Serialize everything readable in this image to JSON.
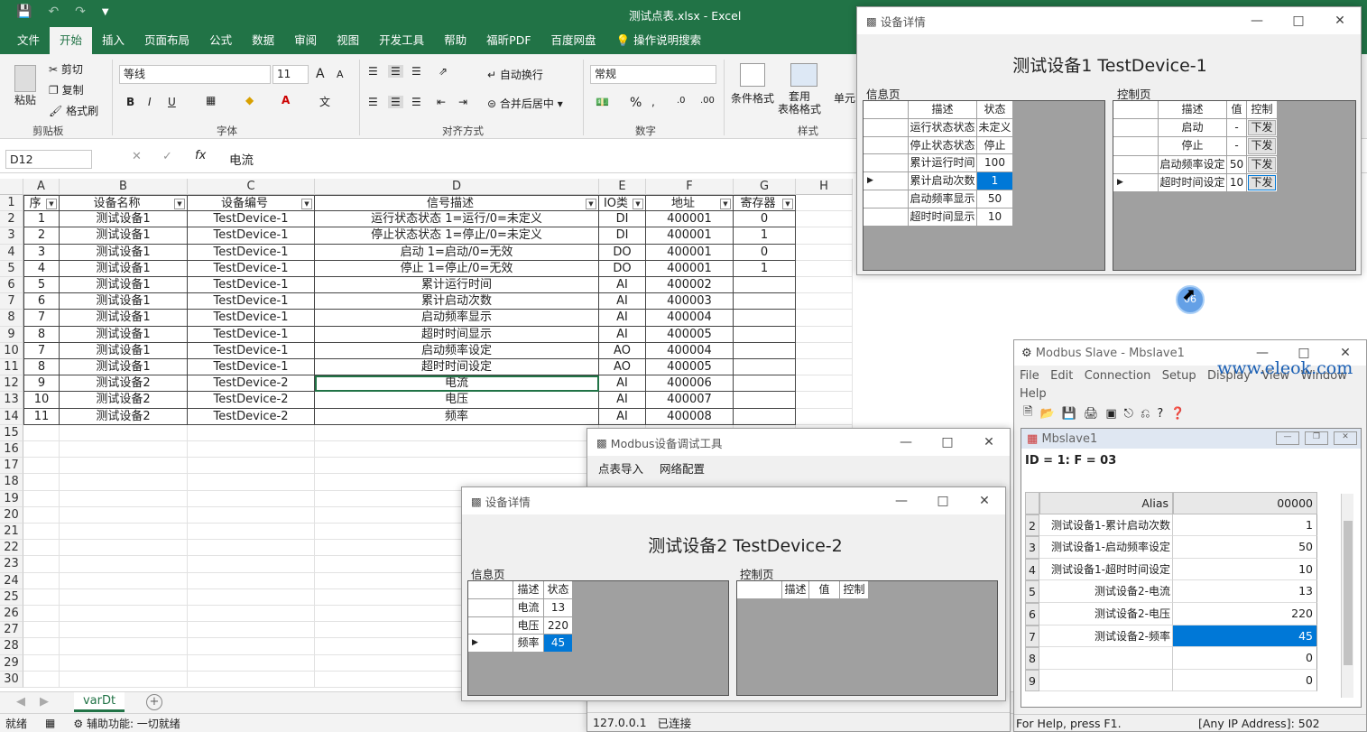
{
  "excel": {
    "title": "测试点表.xlsx  -  Excel",
    "qat_icons": [
      "save-icon",
      "undo-icon",
      "redo-icon",
      "customize-icon"
    ],
    "tabs": [
      "文件",
      "开始",
      "插入",
      "页面布局",
      "公式",
      "数据",
      "审阅",
      "视图",
      "开发工具",
      "帮助",
      "福昕PDF",
      "百度网盘",
      "操作说明搜索"
    ],
    "ribbon": {
      "clipboard": {
        "paste": "粘贴",
        "cut": "剪切",
        "copy": "复制",
        "format_painter": "格式刷",
        "label": "剪贴板"
      },
      "font": {
        "name": "等线",
        "size": "11",
        "label": "字体",
        "bold": "B",
        "italic": "I",
        "underline": "U",
        "grow": "A",
        "shrink": "A"
      },
      "align": {
        "wrap": "自动换行",
        "merge": "合并后居中",
        "label": "对齐方式"
      },
      "number": {
        "format": "常规",
        "label": "数字",
        "percent": "%"
      },
      "styles": {
        "cond": "条件格式",
        "table_format": "套用\n表格格式",
        "cell_styles": "单元",
        "label": "样式"
      }
    },
    "namebox": "D12",
    "formula": "电流",
    "fx": "fx",
    "columns": [
      "A",
      "B",
      "C",
      "D",
      "E",
      "F",
      "G",
      "H"
    ],
    "headers": [
      "序",
      "设备名称",
      "设备编号",
      "信号描述",
      "IO类",
      "地址",
      "寄存器"
    ],
    "rows": [
      [
        "1",
        "测试设备1",
        "TestDevice-1",
        "运行状态状态 1=运行/0=未定义",
        "DI",
        "400001",
        "0"
      ],
      [
        "2",
        "测试设备1",
        "TestDevice-1",
        "停止状态状态 1=停止/0=未定义",
        "DI",
        "400001",
        "1"
      ],
      [
        "3",
        "测试设备1",
        "TestDevice-1",
        "启动 1=启动/0=无效",
        "DO",
        "400001",
        "0"
      ],
      [
        "4",
        "测试设备1",
        "TestDevice-1",
        "停止 1=停止/0=无效",
        "DO",
        "400001",
        "1"
      ],
      [
        "5",
        "测试设备1",
        "TestDevice-1",
        "累计运行时间",
        "AI",
        "400002",
        ""
      ],
      [
        "6",
        "测试设备1",
        "TestDevice-1",
        "累计启动次数",
        "AI",
        "400003",
        ""
      ],
      [
        "7",
        "测试设备1",
        "TestDevice-1",
        "启动频率显示",
        "AI",
        "400004",
        ""
      ],
      [
        "8",
        "测试设备1",
        "TestDevice-1",
        "超时时间显示",
        "AI",
        "400005",
        ""
      ],
      [
        "7",
        "测试设备1",
        "TestDevice-1",
        "启动频率设定",
        "AO",
        "400004",
        ""
      ],
      [
        "8",
        "测试设备1",
        "TestDevice-1",
        "超时时间设定",
        "AO",
        "400005",
        ""
      ],
      [
        "9",
        "测试设备2",
        "TestDevice-2",
        "电流",
        "AI",
        "400006",
        ""
      ],
      [
        "10",
        "测试设备2",
        "TestDevice-2",
        "电压",
        "AI",
        "400007",
        ""
      ],
      [
        "11",
        "测试设备2",
        "TestDevice-2",
        "频率",
        "AI",
        "400008",
        ""
      ]
    ],
    "row_numbers": [
      "1",
      "2",
      "3",
      "4",
      "5",
      "6",
      "7",
      "8",
      "9",
      "10",
      "11",
      "12",
      "13",
      "14",
      "15",
      "16",
      "17",
      "18",
      "19",
      "20",
      "21",
      "22",
      "23",
      "24",
      "25",
      "26",
      "27",
      "28",
      "29",
      "30"
    ],
    "sheet_tab": "varDt",
    "status": {
      "ready": "就绪",
      "accessibility": "辅助功能: 一切就绪"
    }
  },
  "dev1": {
    "win_title": "设备详情",
    "heading": "测试设备1  TestDevice-1",
    "info_label": "信息页",
    "ctrl_label": "控制页",
    "info_cols": [
      "描述",
      "状态"
    ],
    "info_rows": [
      [
        "运行状态状态",
        "未定义"
      ],
      [
        "停止状态状态",
        "停止"
      ],
      [
        "累计运行时间",
        "100"
      ],
      [
        "累计启动次数",
        "1"
      ],
      [
        "启动频率显示",
        "50"
      ],
      [
        "超时时间显示",
        "10"
      ]
    ],
    "ctrl_cols": [
      "描述",
      "值",
      "控制"
    ],
    "ctrl_rows": [
      [
        "启动",
        "-",
        "下发"
      ],
      [
        "停止",
        "-",
        "下发"
      ],
      [
        "启动频率设定",
        "50",
        "下发"
      ],
      [
        "超时时间设定",
        "10",
        "下发"
      ]
    ]
  },
  "tool": {
    "win_title": "Modbus设备调试工具",
    "menu": [
      "点表导入",
      "网络配置"
    ],
    "status_ip": "127.0.0.1",
    "status_conn": "已连接"
  },
  "dev2": {
    "win_title": "设备详情",
    "heading": "测试设备2  TestDevice-2",
    "info_label": "信息页",
    "ctrl_label": "控制页",
    "info_cols": [
      "描述",
      "状态"
    ],
    "info_rows": [
      [
        "电流",
        "13"
      ],
      [
        "电压",
        "220"
      ],
      [
        "频率",
        "45"
      ]
    ],
    "ctrl_cols": [
      "描述",
      "值",
      "控制"
    ]
  },
  "mbslave": {
    "app_title": "Modbus Slave - Mbslave1",
    "menu": [
      "File",
      "Edit",
      "Connection",
      "Setup",
      "Display",
      "View",
      "Window",
      "Help"
    ],
    "doc_title": "Mbslave1",
    "id_line": "ID = 1: F = 03",
    "col_alias": "Alias",
    "col_addr": "00000",
    "rows": [
      [
        "2",
        "测试设备1-累计启动次数",
        "1"
      ],
      [
        "3",
        "测试设备1-启动频率设定",
        "50"
      ],
      [
        "4",
        "测试设备1-超时时间设定",
        "10"
      ],
      [
        "5",
        "测试设备2-电流",
        "13"
      ],
      [
        "6",
        "测试设备2-电压",
        "220"
      ],
      [
        "7",
        "测试设备2-频率",
        "45"
      ],
      [
        "8",
        "",
        "0"
      ],
      [
        "9",
        "",
        "0"
      ]
    ],
    "status_help": "For Help, press F1.",
    "status_ip": "[Any IP Address]: 502",
    "watermark": "www.eleok.com"
  },
  "cursor_badge": "06",
  "colors": {
    "excel_green": "#217346",
    "selection": "#0078d7",
    "dgv_bg": "#a0a0a0"
  }
}
